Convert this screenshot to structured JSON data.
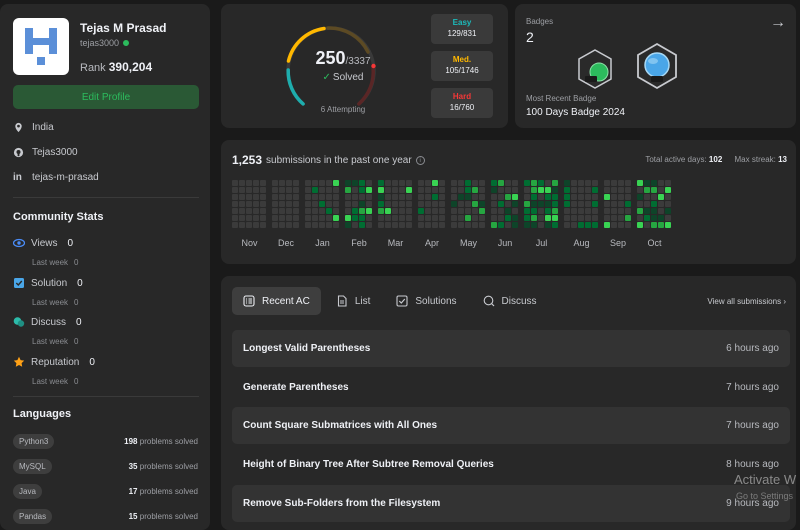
{
  "profile": {
    "name": "Tejas M Prasad",
    "handle": "tejas3000",
    "rank_label": "Rank",
    "rank_value": "390,204",
    "edit_label": "Edit Profile",
    "location": "India",
    "github": "Tejas3000",
    "linkedin": "tejas-m-prasad"
  },
  "community": {
    "title": "Community Stats",
    "stats": [
      {
        "label": "Views",
        "value": "0",
        "sub": "Last week",
        "sub_value": "0",
        "icon": "eye-icon",
        "color": "#4a8cf7"
      },
      {
        "label": "Solution",
        "value": "0",
        "sub": "Last week",
        "sub_value": "0",
        "icon": "check-square-icon",
        "color": "#4aa6e8"
      },
      {
        "label": "Discuss",
        "value": "0",
        "sub": "Last week",
        "sub_value": "0",
        "icon": "chat-bubbles-icon",
        "color": "#2cbbaa"
      },
      {
        "label": "Reputation",
        "value": "0",
        "sub": "Last week",
        "sub_value": "0",
        "icon": "star-icon",
        "color": "#ffa116"
      }
    ]
  },
  "languages": {
    "title": "Languages",
    "items": [
      {
        "name": "Python3",
        "count": "198",
        "suffix": "problems solved"
      },
      {
        "name": "MySQL",
        "count": "35",
        "suffix": "problems solved"
      },
      {
        "name": "Java",
        "count": "17",
        "suffix": "problems solved"
      },
      {
        "name": "Pandas",
        "count": "15",
        "suffix": "problems solved"
      }
    ]
  },
  "solved": {
    "count": "250",
    "total": "/3337",
    "label": "Solved",
    "attempting": "6 Attempting",
    "difficulties": [
      {
        "label": "Easy",
        "value": "129/831",
        "color": "#1cbaba"
      },
      {
        "label": "Med.",
        "value": "105/1746",
        "color": "#ffb800"
      },
      {
        "label": "Hard",
        "value": "16/760",
        "color": "#f63737"
      }
    ]
  },
  "badges": {
    "label": "Badges",
    "count": "2",
    "recent_label": "Most Recent Badge",
    "recent_name": "100 Days Badge 2024"
  },
  "heatmap": {
    "count": "1,253",
    "label": "submissions in the past one year",
    "active_label": "Total active days:",
    "active_value": "102",
    "streak_label": "Max streak:",
    "streak_value": "13",
    "months": [
      "Nov",
      "Dec",
      "Jan",
      "Feb",
      "Mar",
      "Apr",
      "May",
      "Jun",
      "Jul",
      "Aug",
      "Sep",
      "Oct"
    ]
  },
  "submissions": {
    "tabs": [
      {
        "label": "Recent AC",
        "icon": "list-check-icon"
      },
      {
        "label": "List",
        "icon": "document-icon"
      },
      {
        "label": "Solutions",
        "icon": "check-box-icon"
      },
      {
        "label": "Discuss",
        "icon": "discuss-icon"
      }
    ],
    "view_all": "View all submissions",
    "rows": [
      {
        "title": "Longest Valid Parentheses",
        "ago": "6 hours ago"
      },
      {
        "title": "Generate Parentheses",
        "ago": "7 hours ago"
      },
      {
        "title": "Count Square Submatrices with All Ones",
        "ago": "7 hours ago"
      },
      {
        "title": "Height of Binary Tree After Subtree Removal Queries",
        "ago": "8 hours ago"
      },
      {
        "title": "Remove Sub-Folders from the Filesystem",
        "ago": "9 hours ago"
      }
    ]
  },
  "watermark": {
    "line1": "Activate W",
    "line2": "Go to Settings"
  }
}
